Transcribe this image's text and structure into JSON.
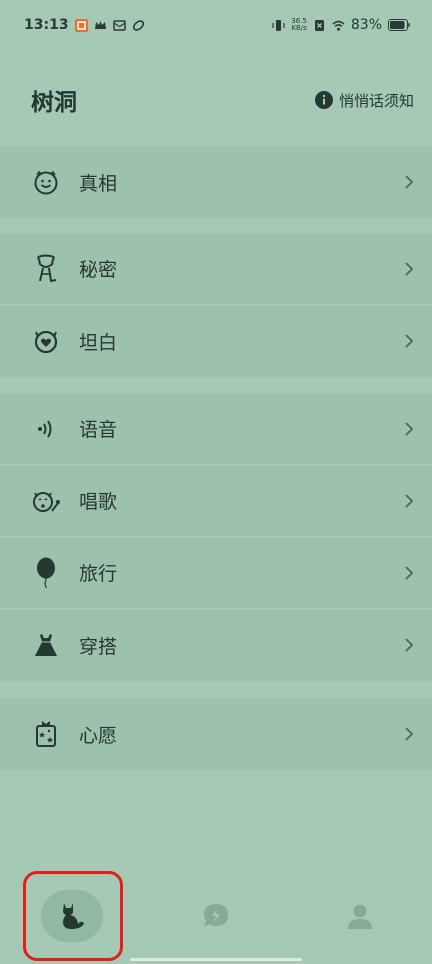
{
  "status_bar": {
    "time": "13:13",
    "net_speed_value": "36.5",
    "net_speed_unit": "KB/s",
    "battery": "83%"
  },
  "header": {
    "title": "树洞",
    "notice_label": "悄悄话须知"
  },
  "groups": [
    {
      "items": [
        {
          "label": "真相",
          "icon": "smiley-face-icon"
        }
      ]
    },
    {
      "items": [
        {
          "label": "秘密",
          "icon": "cat-figure-icon"
        },
        {
          "label": "坦白",
          "icon": "heart-cat-icon"
        }
      ]
    },
    {
      "items": [
        {
          "label": "语音",
          "icon": "voice-waves-icon"
        },
        {
          "label": "唱歌",
          "icon": "singing-face-icon"
        },
        {
          "label": "旅行",
          "icon": "balloon-icon"
        },
        {
          "label": "穿搭",
          "icon": "dress-icon"
        }
      ]
    },
    {
      "items": [
        {
          "label": "心愿",
          "icon": "wish-jar-icon"
        }
      ]
    }
  ],
  "tabbar": {
    "tabs": [
      {
        "icon": "cat-icon",
        "active": true
      },
      {
        "icon": "chat-bolt-icon",
        "active": false
      },
      {
        "icon": "person-icon",
        "active": false
      }
    ]
  },
  "colors": {
    "background": "#a6c9b5",
    "row_background": "#9ec1ad",
    "text": "#243a31",
    "highlight": "#e0201c"
  }
}
